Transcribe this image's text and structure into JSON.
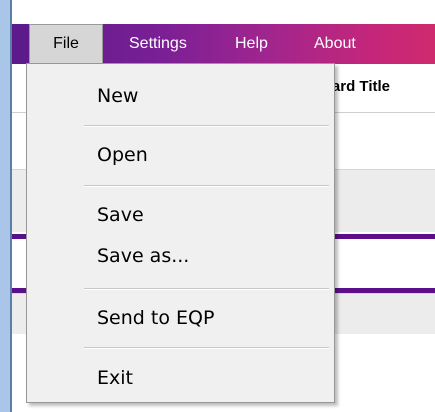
{
  "menubar": {
    "file": "File",
    "settings": "Settings",
    "help": "Help",
    "about": "About"
  },
  "content": {
    "column_header": "ard Title"
  },
  "file_menu": {
    "items": [
      "New",
      "Open",
      "Save",
      "Save as...",
      "Send to EQP",
      "Exit"
    ]
  },
  "colors": {
    "menubar_start": "#5b1a8a",
    "menubar_end": "#cf2a6e",
    "divider_purple": "#5b0f8a"
  }
}
